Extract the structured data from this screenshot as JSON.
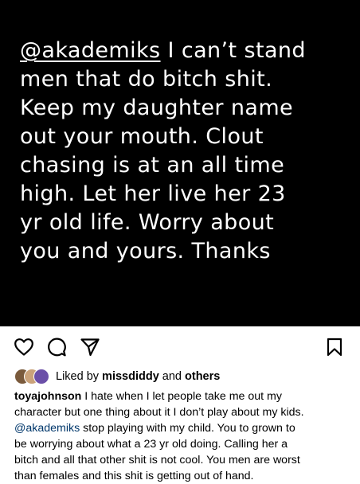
{
  "story": {
    "mention": "@akademiks",
    "first_line_rest": " I can’t stand",
    "lines": [
      "men that do bitch shit.",
      "Keep my daughter name",
      "out your mouth.  Clout",
      "chasing is at an all time",
      "high. Let her live her 23",
      "yr old life.  Worry about",
      "you and yours.   Thanks"
    ]
  },
  "actions": {
    "like_icon": "heart-outline-icon",
    "comment_icon": "comment-bubble-icon",
    "share_icon": "paper-plane-icon",
    "save_icon": "bookmark-icon"
  },
  "likes": {
    "prefix": "Liked by ",
    "user": "missdiddy",
    "middle": " and ",
    "others": "others",
    "avatar_colors": [
      "#7a5a3c",
      "#caa27a",
      "#6b4fa8"
    ]
  },
  "caption": {
    "username": "toyajohnson",
    "line1_rest": " I hate when I let people take me out my",
    "line2": "character but one thing about it I don’t play about my kids.",
    "mention": "@akademiks",
    "line3_rest": " stop playing with my child.  You to grown to",
    "line4": "be worrying about what a 23 yr old doing.  Calling her a",
    "line5": "bitch and all that other shit is not cool.  You men are worst",
    "line6": "than females and this shit is getting out of hand."
  }
}
